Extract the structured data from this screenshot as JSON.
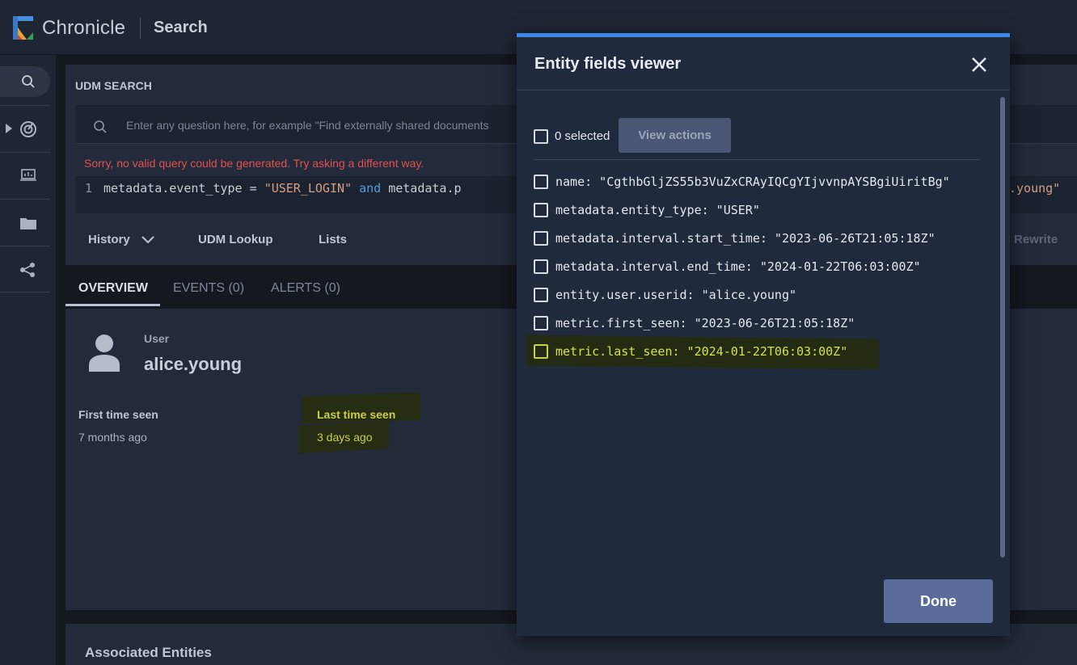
{
  "topbar": {
    "brand": "Chronicle",
    "section": "Search"
  },
  "udm": {
    "label": "UDM SEARCH",
    "search_placeholder": "Enter any question here, for example \"Find externally shared documents",
    "error": "Sorry, no valid query could be generated. Try asking a different way.",
    "query": {
      "line_number": "1",
      "part1": "metadata.event_type = ",
      "str1": "\"USER_LOGIN\"",
      "kw": " and ",
      "part2": "metadata.p",
      "tail": ".young\""
    },
    "tabs": [
      "History",
      "UDM Lookup",
      "Lists"
    ],
    "rewrite": "Rewrite"
  },
  "overview": {
    "tabs": [
      "OVERVIEW",
      "EVENTS (0)",
      "ALERTS (0)"
    ],
    "user_label": "User",
    "user_name": "alice.young",
    "first_seen_label": "First time seen",
    "first_seen_value": "7 months ago",
    "last_seen_label": "Last time seen",
    "last_seen_value": "3 days ago"
  },
  "associated": {
    "title": "Associated Entities"
  },
  "modal": {
    "title": "Entity fields viewer",
    "selected_text": "0 selected",
    "view_actions": "View actions",
    "fields": [
      "name: \"CgthbGljZS55b3VuZxCRAyIQCgYIjvvnpAYSBgiUiritBg\"",
      "metadata.entity_type: \"USER\"",
      "metadata.interval.start_time: \"2023-06-26T21:05:18Z\"",
      "metadata.interval.end_time: \"2024-01-22T06:03:00Z\"",
      "entity.user.userid: \"alice.young\"",
      "metric.first_seen: \"2023-06-26T21:05:18Z\"",
      "metric.last_seen: \"2024-01-22T06:03:00Z\""
    ],
    "done": "Done"
  },
  "colors": {
    "accent": "#3b86e8",
    "highlight": "#d8e04a",
    "error": "#e05050"
  }
}
